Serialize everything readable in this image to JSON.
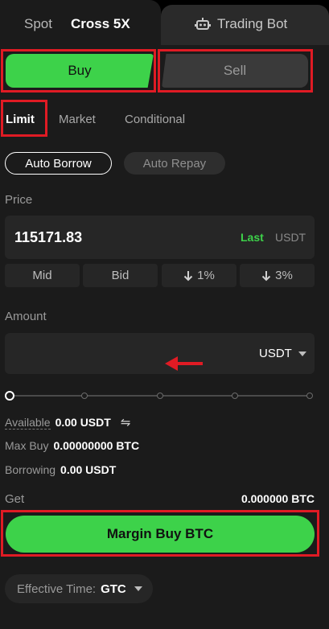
{
  "tabs": {
    "spot": "Spot",
    "cross": "Cross 5X",
    "trading_bot": "Trading Bot"
  },
  "side": {
    "buy": "Buy",
    "sell": "Sell"
  },
  "order_types": [
    "Limit",
    "Market",
    "Conditional"
  ],
  "borrow": {
    "auto_borrow": "Auto Borrow",
    "auto_repay": "Auto Repay"
  },
  "price": {
    "label": "Price",
    "value": "115171.83",
    "last": "Last",
    "unit": "USDT"
  },
  "quick_buttons": [
    "Mid",
    "Bid",
    "1%",
    "3%"
  ],
  "amount": {
    "label": "Amount",
    "unit": "USDT"
  },
  "slider": {
    "value_fraction": 0
  },
  "info": {
    "available_label": "Available",
    "available_value": "0.00 USDT",
    "max_buy_label": "Max Buy",
    "max_buy_value": "0.00000000 BTC",
    "borrowing_label": "Borrowing",
    "borrowing_value": "0.00 USDT"
  },
  "get": {
    "label": "Get",
    "value": "0.000000 BTC"
  },
  "submit": "Margin Buy BTC",
  "effective_time": {
    "label": "Effective Time:",
    "value": "GTC"
  },
  "colors": {
    "accent_green": "#3dd24a",
    "annotation_red": "#e01b24",
    "panel_bg": "#1b1b1b"
  }
}
